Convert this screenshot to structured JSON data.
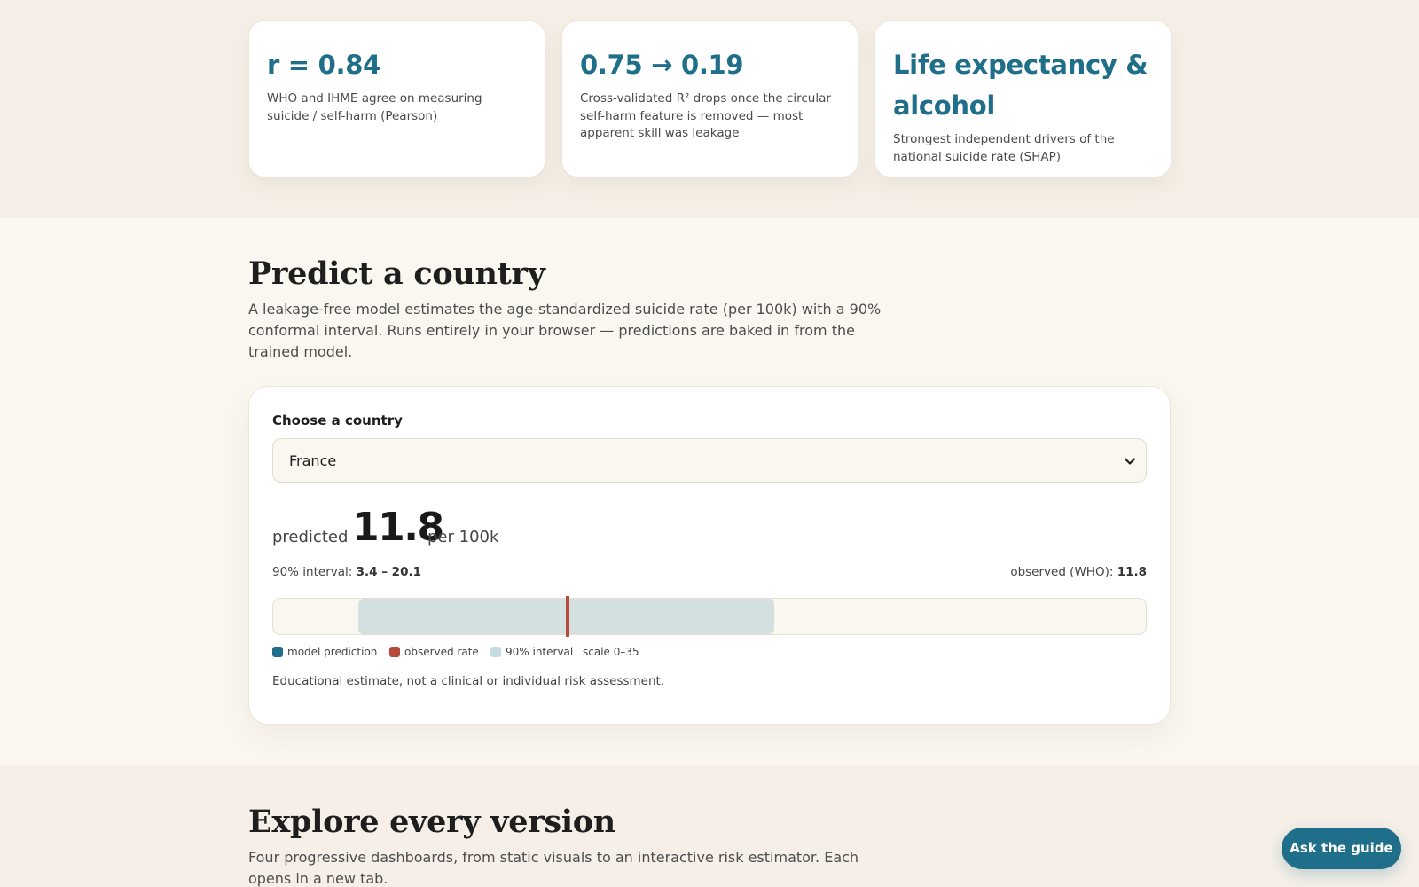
{
  "colors": {
    "accent": "#1f6f8b",
    "observed": "#b84a3c",
    "interval": "#d4e0df",
    "page_bg": "#f5efe7",
    "section_bg": "#faf7f0"
  },
  "stats": [
    {
      "value": "r = 0.84",
      "desc": "WHO and IHME agree on measuring suicide / self-harm (Pearson)"
    },
    {
      "value": "0.75 → 0.19",
      "desc": "Cross-validated R² drops once the circular self-harm feature is removed — most apparent skill was leakage"
    },
    {
      "value": "Life expectancy & alcohol",
      "desc": "Strongest independent drivers of the national suicide rate (SHAP)"
    }
  ],
  "predict": {
    "title": "Predict a country",
    "subtitle": "A leakage-free model estimates the age-standardized suicide rate (per 100k) with a 90% conformal interval. Runs entirely in your browser — predictions are baked in from the trained model.",
    "choose_label": "Choose a country",
    "selected_country": "France",
    "predicted_word": "predicted",
    "predicted_value": "11.8",
    "unit": "per 100k",
    "interval_label": "90% interval: ",
    "interval_value": "3.4 – 20.1",
    "observed_label": "observed (WHO): ",
    "observed_value": "11.8",
    "scale": {
      "min": 0,
      "max": 35,
      "predicted": 11.8,
      "observed": 11.8,
      "interval_low": 3.4,
      "interval_high": 20.1
    },
    "legend": {
      "prediction": "model prediction",
      "observed": "observed rate",
      "interval": "90% interval",
      "scale": "scale 0–35"
    },
    "disclaimer": "Educational estimate, not a clinical or individual risk assessment."
  },
  "explore": {
    "title": "Explore every version",
    "subtitle": "Four progressive dashboards, from static visuals to an interactive risk estimator. Each opens in a new tab."
  },
  "guide_button": "Ask the guide",
  "icons": {
    "select_chevron": "chevron-down-icon"
  }
}
